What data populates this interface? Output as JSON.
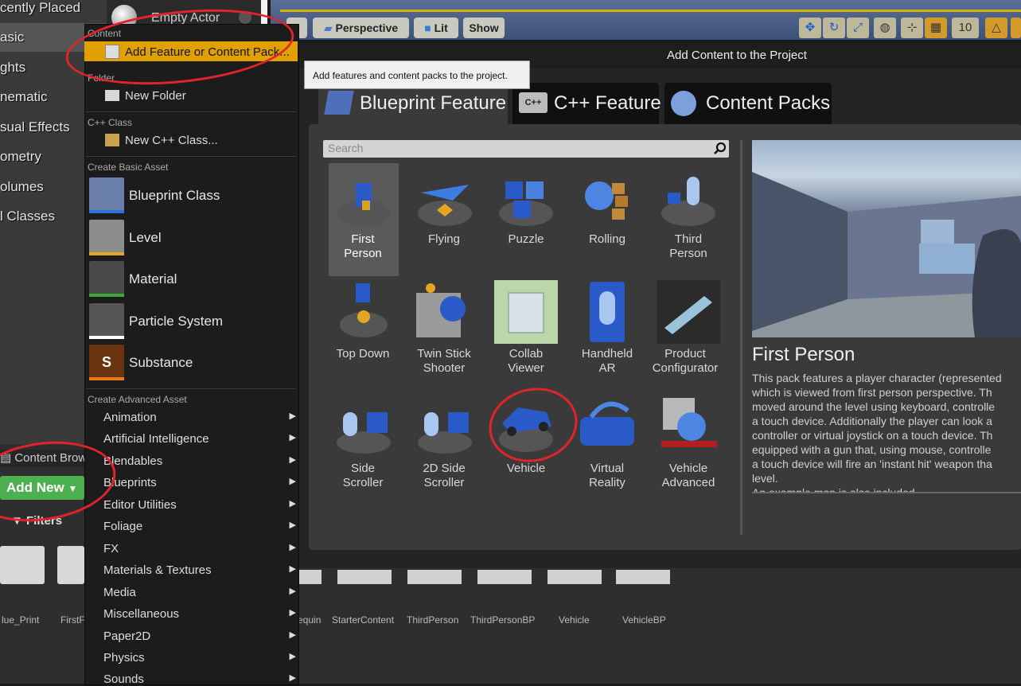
{
  "left_panel": {
    "categories": [
      "cently Placed",
      "asic",
      "ghts",
      "nematic",
      "sual Effects",
      "ometry",
      "olumes",
      "l Classes"
    ]
  },
  "actor_strip": {
    "empty_actor": "Empty Actor"
  },
  "viewport": {
    "perspective": "Perspective",
    "lit": "Lit",
    "show": "Show",
    "grid_snap": "10"
  },
  "content_browser": {
    "tab": "Content Brow",
    "add_new": "Add New",
    "filters": "Filters",
    "assets": [
      "lue_Print",
      "FirstF",
      "equin",
      "StarterContent",
      "ThirdPerson",
      "ThirdPersonBP",
      "Vehicle",
      "VehicleBP"
    ]
  },
  "menu": {
    "content_header": "Content",
    "add_feature": "Add Feature or Content Pack...",
    "folder_header": "Folder",
    "new_folder": "New Folder",
    "cpp_header": "C++ Class",
    "new_cpp": "New C++ Class...",
    "basic_header": "Create Basic Asset",
    "basic_assets": [
      "Blueprint Class",
      "Level",
      "Material",
      "Particle System",
      "Substance"
    ],
    "advanced_header": "Create Advanced Asset",
    "advanced_assets": [
      "Animation",
      "Artificial Intelligence",
      "Blendables",
      "Blueprints",
      "Editor Utilities",
      "Foliage",
      "FX",
      "Materials & Textures",
      "Media",
      "Miscellaneous",
      "Paper2D",
      "Physics",
      "Sounds"
    ]
  },
  "tooltip": "Add features and content packs to the project.",
  "dialog": {
    "title": "Add Content to the Project",
    "tabs": [
      "Blueprint Feature",
      "C++ Feature",
      "Content Packs"
    ],
    "search_placeholder": "Search",
    "tiles": [
      [
        "First",
        "Person"
      ],
      [
        "Flying"
      ],
      [
        "Puzzle"
      ],
      [
        "Rolling"
      ],
      [
        "Third",
        "Person"
      ],
      [
        "Top Down"
      ],
      [
        "Twin Stick",
        "Shooter"
      ],
      [
        "Collab",
        "Viewer"
      ],
      [
        "Handheld",
        "AR"
      ],
      [
        "Product",
        "Configurator"
      ],
      [
        "Side",
        "Scroller"
      ],
      [
        "2D Side",
        "Scroller"
      ],
      [
        "Vehicle"
      ],
      [
        "Virtual",
        "Reality"
      ],
      [
        "Vehicle",
        "Advanced"
      ]
    ],
    "preview_title": "First Person",
    "preview_desc": [
      "This pack features a player character (represented",
      "which is viewed from first person perspective. Th",
      "moved around the level using keyboard, controlle",
      "a touch device. Additionally the player can look a",
      "controller or virtual joystick on a touch device. Th",
      "equipped with a gun that, using mouse, controlle",
      "a touch device will fire an 'instant hit' weapon tha",
      "level.",
      "An example map is also included."
    ]
  },
  "colors": {
    "accent": "#e0a000",
    "add_new": "#4caf50",
    "annotation": "#e0242a"
  }
}
